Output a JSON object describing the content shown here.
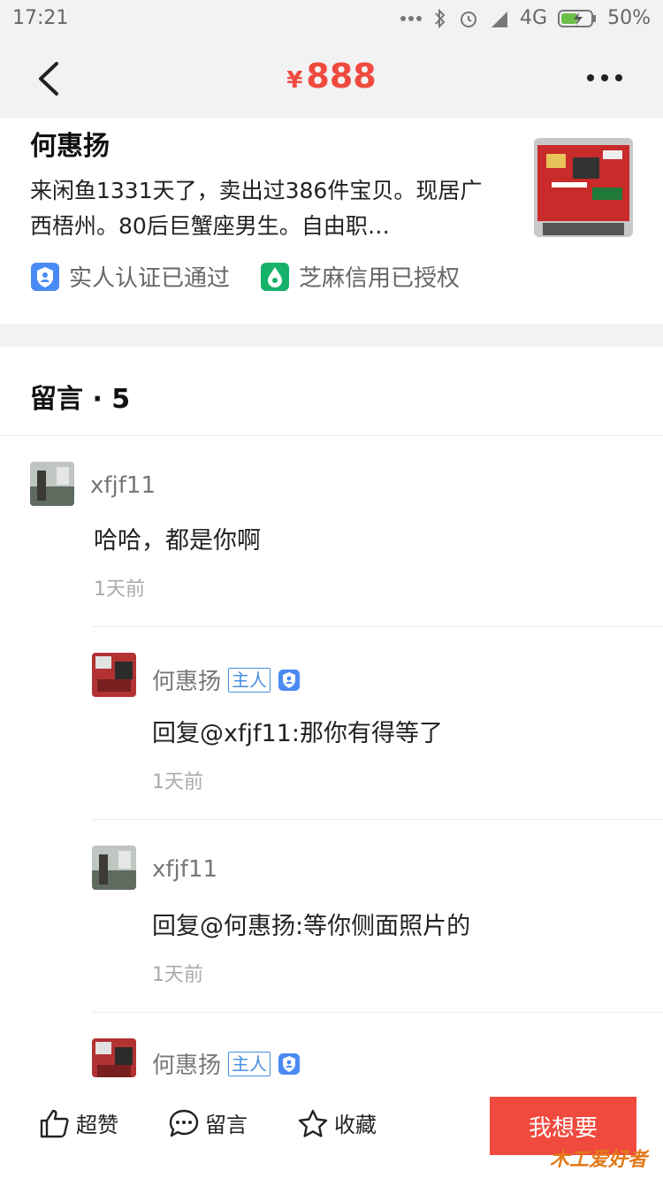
{
  "status_bar": {
    "time": "17:21",
    "network": "4G",
    "battery": "50%",
    "icons": [
      "more-dots-icon",
      "bluetooth-icon",
      "alarm-icon",
      "signal-icon",
      "battery-charging-icon"
    ]
  },
  "header": {
    "currency": "¥",
    "price": "888",
    "back_icon": "chevron-left-icon",
    "more_icon": "more-icon"
  },
  "seller": {
    "name": "何惠扬",
    "description": "来闲鱼1331天了，卖出过386件宝贝。现居广西梧州。80后巨蟹座男生。自由职…",
    "badges": [
      {
        "label": "实人认证已通过",
        "icon": "person-verified-icon"
      },
      {
        "label": "芝麻信用已授权",
        "icon": "sesame-credit-icon"
      }
    ]
  },
  "comments": {
    "title": "留言 · 5",
    "items": [
      {
        "user": "xfjf11",
        "text": "哈哈，都是你啊",
        "time": "1天前",
        "owner": false
      },
      {
        "user": "何惠扬",
        "text": "回复@xfjf11:那你有得等了",
        "time": "1天前",
        "owner": true,
        "owner_label": "主人"
      },
      {
        "user": "xfjf11",
        "text": "回复@何惠扬:等你侧面照片的",
        "time": "1天前",
        "owner": false
      },
      {
        "user": "何惠扬",
        "text": "",
        "time": "",
        "owner": true,
        "owner_label": "主人"
      }
    ]
  },
  "bottom_bar": {
    "like_label": "超赞",
    "comment_label": "留言",
    "favorite_label": "收藏",
    "want_label": "我想要"
  },
  "watermark": "木工爱好者",
  "colors": {
    "accent": "#f04a3e",
    "owner_tag": "#4a90e2",
    "zhima": "#17b26a"
  }
}
